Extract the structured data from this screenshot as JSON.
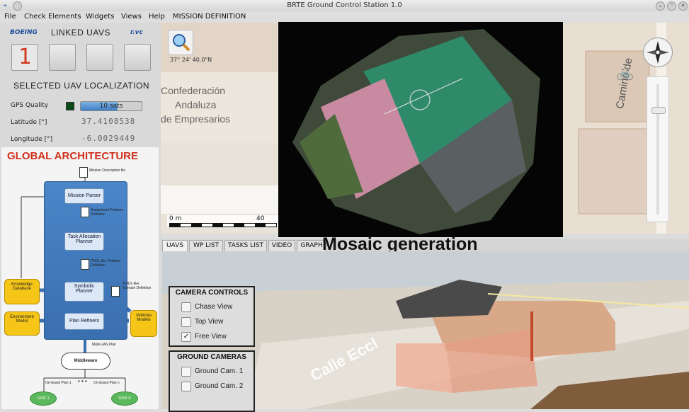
{
  "window": {
    "title": "BRTE Ground Control Station 1.0"
  },
  "menu": [
    "File",
    "Check Elements",
    "Widgets",
    "Views",
    "Help",
    "MISSION DEFINITION"
  ],
  "left": {
    "logo_left": "BOEING",
    "linked_title": "LINKED UAVS",
    "logo_right": "r.vc",
    "uav_buttons": [
      "1",
      "",
      "",
      ""
    ],
    "loc_title": "SELECTED UAV LOCALIZATION",
    "gps_label": "GPS Quality",
    "gps_text": "10 sats",
    "gps_fraction": 0.6,
    "lat_label": "Latitude [°]",
    "lat_value": "37.4108538",
    "lon_label": "Longitude [°]",
    "lon_value": "-6.0029449"
  },
  "arch": {
    "title": "GLOBAL ARCHITECTURE",
    "mission_file": "Mission Description file",
    "mission_parser": "Mission Parser",
    "assign_def": "Assignment Problem Definition",
    "task_alloc": "Task Allocation Planner",
    "pddl_problem": "PDDL-like Problem Definition",
    "symbolic": "Symbolic Planner",
    "pddl_domain": "PDDL-like Domain Definition",
    "plan_refiners": "Plan Refiners",
    "knowledge": "Knowledge Database",
    "environment": "Environment Model",
    "vehicles": "Vehicles Models",
    "multi_plan": "Multi-UAS Plan",
    "middleware": "Middleware",
    "onboard1": "On-board Plan 1",
    "onboardn": "On-board Plan n",
    "dots": "• • •",
    "uas1": "UAS 1",
    "uasn": "UAS n"
  },
  "map": {
    "coord": "37° 24' 40.0\"N",
    "street1": "Confederación",
    "street2": "Andaluza",
    "street3": "de Empresarios",
    "street_right": "Camino de",
    "scale_left": "0 m",
    "scale_right": "40"
  },
  "tabs": [
    "UAVS",
    "WP LIST",
    "TASKS LIST",
    "VIDEO",
    "GRAPH"
  ],
  "overlay_label": "Mosaic generation",
  "camera": {
    "title": "CAMERA CONTROLS",
    "options": [
      {
        "label": "Chase View",
        "checked": false
      },
      {
        "label": "Top View",
        "checked": false
      },
      {
        "label": "Free View",
        "checked": true
      }
    ]
  },
  "ground": {
    "title": "GROUND CAMERAS",
    "options": [
      "Ground Cam. 1",
      "Ground Cam. 2"
    ]
  },
  "scene": {
    "street_label": "Calle Eccl"
  },
  "colors": {
    "accent": "#d4381a",
    "arch_title": "#d0301c"
  }
}
